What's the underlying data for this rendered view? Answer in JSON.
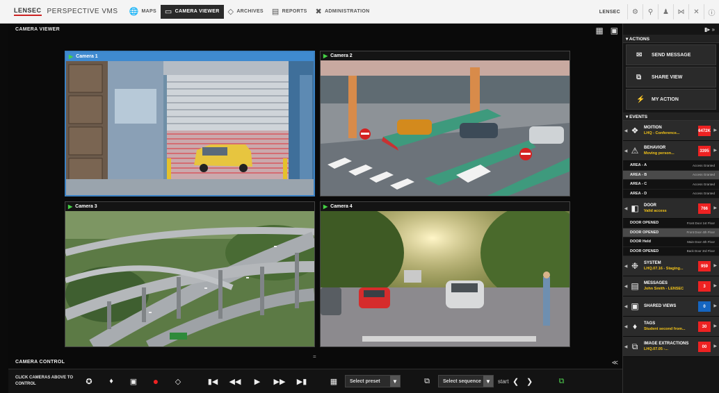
{
  "nav": {
    "logo": "LENSEC",
    "product": "PERSPECTIVE VMS",
    "tabs": [
      {
        "label": "MAPS",
        "icon": "globe-icon"
      },
      {
        "label": "CAMERA VIEWER",
        "icon": "monitor-icon",
        "active": true
      },
      {
        "label": "ARCHIVES",
        "icon": "archive-icon"
      },
      {
        "label": "REPORTS",
        "icon": "report-icon"
      },
      {
        "label": "ADMINISTRATION",
        "icon": "tools-icon"
      }
    ],
    "user": "LENSEC"
  },
  "viewer": {
    "title": "CAMERA VIEWER",
    "cameras": [
      {
        "label": "Camera 1",
        "selected": true
      },
      {
        "label": "Camera 2",
        "selected": false
      },
      {
        "label": "Camera 3",
        "selected": false
      },
      {
        "label": "Camera 4",
        "selected": false
      }
    ],
    "divider": "="
  },
  "control": {
    "title": "CAMERA CONTROL",
    "hint": "CLICK CAMERAS ABOVE TO CONTROL",
    "preset_placeholder": "Select preset",
    "sequence_placeholder": "Select sequence",
    "start_label": "start"
  },
  "side": {
    "actions_header": "▾ ACTIONS",
    "actions": [
      "SEND MESSAGE",
      "SHARE VIEW",
      "MY ACTION"
    ],
    "events_header": "▾ EVENTS",
    "motion": {
      "title": "MOITION",
      "sub": "LHQ - Conference...",
      "count": "6472K"
    },
    "behavior": {
      "title": "BEHAVIOR",
      "sub": "Moving person...",
      "count": "3395"
    },
    "areas": [
      {
        "name": "AREA - A",
        "status": "Access Granted"
      },
      {
        "name": "AREA - B",
        "status": "Access Granted"
      },
      {
        "name": "AREA - C",
        "status": "Access Granted"
      },
      {
        "name": "AREA - D",
        "status": "Access Granted"
      }
    ],
    "door": {
      "title": "DOOR",
      "sub": "Valid access",
      "count": "766"
    },
    "doors": [
      {
        "name": "DOOR OPENED",
        "loc": "Front Door 1st Floor"
      },
      {
        "name": "DOOR OPENED",
        "loc": "Front Door 4th Floor"
      },
      {
        "name": "DOOR Held",
        "loc": "Main Door 4th Floor"
      },
      {
        "name": "DOOR OPENED",
        "loc": "Back Door 3rd Floor"
      }
    ],
    "system": {
      "title": "SYSTEM",
      "sub": "LHQ.07.16 - Staging...",
      "count": "959"
    },
    "messages": {
      "title": "MESSAGES",
      "sub": "John Smith - LENSEC",
      "count": "3"
    },
    "shared": {
      "title": "SHARED VIEWS",
      "sub": "",
      "count": "0"
    },
    "tags": {
      "title": "TAGS",
      "sub": "Student second from...",
      "count": "30"
    },
    "extractions": {
      "title": "IMAGE EXTRACTIONS",
      "sub": "LHQ.07.05 -...",
      "count": "00"
    }
  }
}
